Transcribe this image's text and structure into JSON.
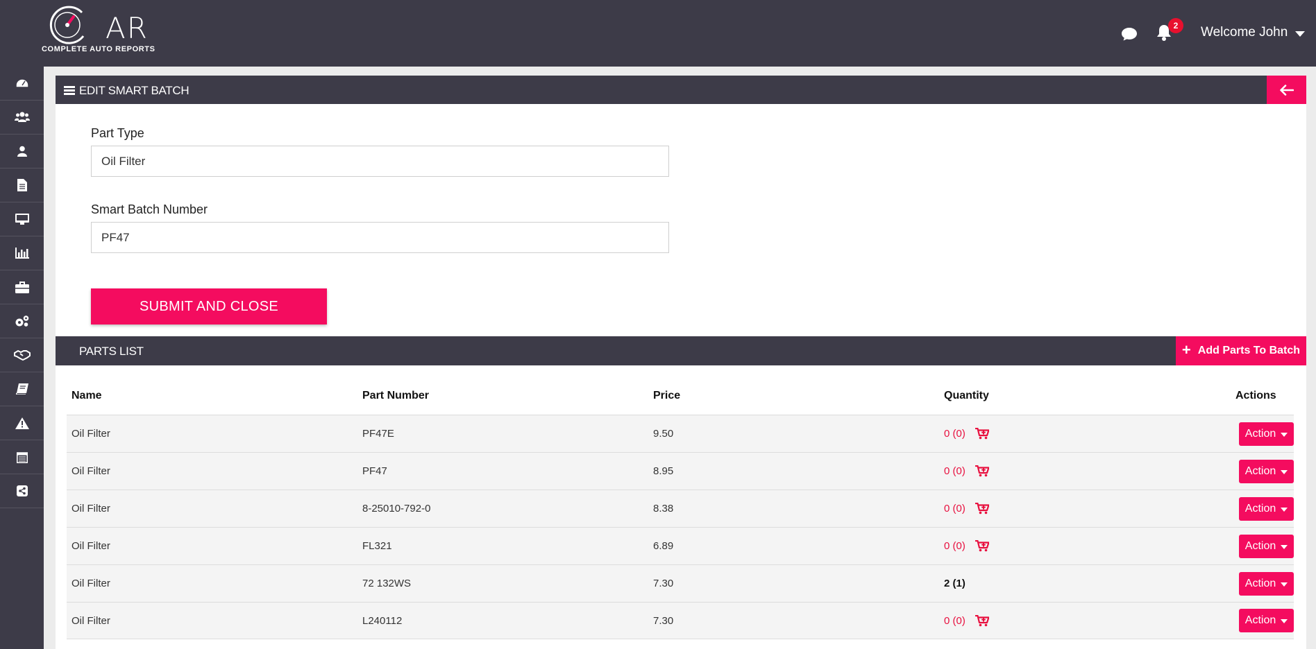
{
  "header": {
    "logo_text": "AR",
    "logo_subtitle": "COMPLETE AUTO REPORTS",
    "notification_count": "2",
    "welcome": "Welcome John"
  },
  "sidebar": {
    "items": [
      {
        "icon": "dashboard-icon"
      },
      {
        "icon": "users-icon"
      },
      {
        "icon": "user-icon"
      },
      {
        "icon": "document-icon"
      },
      {
        "icon": "monitor-icon"
      },
      {
        "icon": "bar-chart-icon"
      },
      {
        "icon": "briefcase-icon"
      },
      {
        "icon": "cogs-icon"
      },
      {
        "icon": "handshake-icon"
      },
      {
        "icon": "book-icon"
      },
      {
        "icon": "warning-icon"
      },
      {
        "icon": "calendar-icon"
      },
      {
        "icon": "share-icon"
      }
    ]
  },
  "edit_panel": {
    "title": "EDIT SMART BATCH",
    "part_type_label": "Part Type",
    "part_type_value": "Oil Filter",
    "batch_number_label": "Smart Batch Number",
    "batch_number_value": "PF47",
    "submit_label": "SUBMIT AND CLOSE"
  },
  "parts_panel": {
    "title": "PARTS LIST",
    "add_button_label": "Add Parts To Batch",
    "columns": {
      "name": "Name",
      "part_number": "Part Number",
      "price": "Price",
      "quantity": "Quantity",
      "actions": "Actions"
    },
    "action_label": "Action",
    "rows": [
      {
        "name": "Oil Filter",
        "part_number": "PF47E",
        "price": "9.50",
        "quantity": "0 (0)"
      },
      {
        "name": "Oil Filter",
        "part_number": "PF47",
        "price": "8.95",
        "quantity": "0 (0)"
      },
      {
        "name": "Oil Filter",
        "part_number": "8-25010-792-0",
        "price": "8.38",
        "quantity": "0 (0)"
      },
      {
        "name": "Oil Filter",
        "part_number": "FL321",
        "price": "6.89",
        "quantity": "0 (0)"
      },
      {
        "name": "Oil Filter",
        "part_number": "72 132WS",
        "price": "7.30",
        "quantity": "2 (1)"
      },
      {
        "name": "Oil Filter",
        "part_number": "L240112",
        "price": "7.30",
        "quantity": "0 (0)"
      }
    ]
  },
  "colors": {
    "dark": "#3d3b48",
    "accent": "#f40c5f"
  }
}
